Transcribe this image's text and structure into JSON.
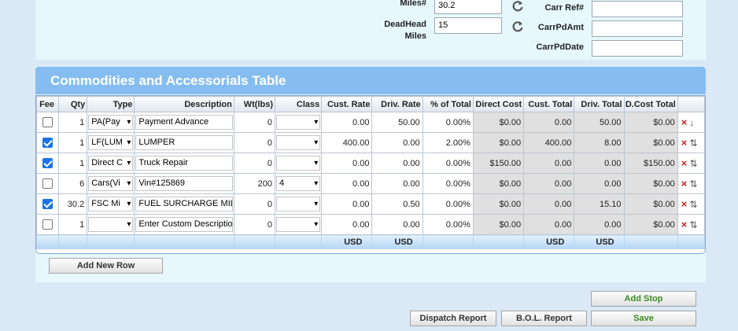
{
  "top": {
    "miles_label": "Miles#",
    "miles_value": "30.2",
    "deadhead_label_1": "DeadHead",
    "deadhead_label_2": "Miles",
    "deadhead_value": "15",
    "carr_ref_label": "Carr Ref#",
    "carr_ref_value": "",
    "carr_pd_amt_label": "CarrPdAmt",
    "carr_pd_amt_value": "",
    "carr_pd_date_label": "CarrPdDate",
    "carr_pd_date_value": ""
  },
  "grid": {
    "title": "Commodities and Accessorials Table",
    "headers": [
      "Fee",
      "Qty",
      "Type",
      "Description",
      "Wt(lbs)",
      "Class",
      "Cust. Rate",
      "Driv. Rate",
      "% of Total",
      "Direct Cost",
      "Cust. Total",
      "Driv. Total",
      "D.Cost Total"
    ],
    "rows": [
      {
        "fee": false,
        "qty": "1",
        "type": "PA(Pay",
        "description": "Payment Advance",
        "wt": "0",
        "class": "",
        "cust_rate": "0.00",
        "driv_rate": "50.00",
        "pct": "0.00%",
        "direct_cost": "$0.00",
        "cust_total": "0.00",
        "driv_total": "50.00",
        "dcost_total": "$0.00",
        "arrow": "↓"
      },
      {
        "fee": true,
        "qty": "1",
        "type": "LF(LUM",
        "description": "LUMPER",
        "wt": "0",
        "class": "",
        "cust_rate": "400.00",
        "driv_rate": "0.00",
        "pct": "2.00%",
        "direct_cost": "$0.00",
        "cust_total": "400.00",
        "driv_total": "8.00",
        "dcost_total": "$0.00",
        "arrow": "⇅"
      },
      {
        "fee": true,
        "qty": "1",
        "type": "Direct C",
        "description": "Truck Repair",
        "wt": "0",
        "class": "",
        "cust_rate": "0.00",
        "driv_rate": "0.00",
        "pct": "0.00%",
        "direct_cost": "$150.00",
        "cust_total": "0.00",
        "driv_total": "0.00",
        "dcost_total": "$150.00",
        "arrow": "⇅"
      },
      {
        "fee": false,
        "qty": "6",
        "type": "Cars(Vi",
        "description": "Vin#125869",
        "wt": "200",
        "class": "4",
        "cust_rate": "0.00",
        "driv_rate": "0.00",
        "pct": "0.00%",
        "direct_cost": "$0.00",
        "cust_total": "0.00",
        "driv_total": "0.00",
        "dcost_total": "$0.00",
        "arrow": "⇅"
      },
      {
        "fee": true,
        "qty": "30.2",
        "type": "FSC Mi",
        "description": "FUEL SURCHARGE MIL",
        "wt": "0",
        "class": "",
        "cust_rate": "0.00",
        "driv_rate": "0.50",
        "pct": "0.00%",
        "direct_cost": "$0.00",
        "cust_total": "0.00",
        "driv_total": "15.10",
        "dcost_total": "$0.00",
        "arrow": "⇅"
      },
      {
        "fee": false,
        "qty": "1",
        "type": "",
        "description": "Enter Custom Descriptio",
        "wt": "0",
        "class": "",
        "cust_rate": "0.00",
        "driv_rate": "0.00",
        "pct": "0.00%",
        "direct_cost": "$0.00",
        "cust_total": "0.00",
        "driv_total": "0.00",
        "dcost_total": "$0.00",
        "arrow": "⇅"
      }
    ],
    "footer": {
      "cust_rate": "USD",
      "driv_rate": "USD",
      "cust_total": "USD",
      "driv_total": "USD"
    },
    "delete_icon": "×",
    "chevron_icon": "▾"
  },
  "buttons": {
    "add_new_row": "Add New Row",
    "add_stop": "Add Stop",
    "dispatch_report": "Dispatch Report",
    "bol_report": "B.O.L. Report",
    "save": "Save"
  },
  "colors": {
    "header_bar": "#85bdf0",
    "panel": "#e6f8fb",
    "delete": "#d02020",
    "checkbox": "#1a73e8",
    "green_text": "#3c8a23"
  }
}
